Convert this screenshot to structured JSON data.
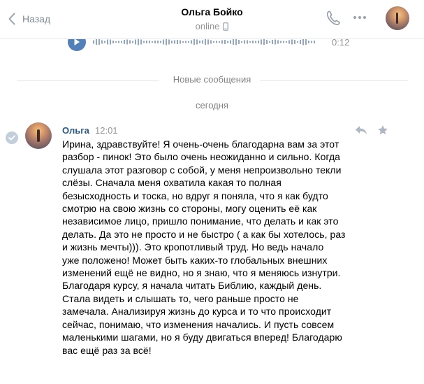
{
  "header": {
    "back_label": "Назад",
    "title": "Ольга Бойко",
    "status": "online"
  },
  "audio": {
    "duration": "0:12"
  },
  "separators": {
    "new_messages": "Новые сообщения",
    "date": "сегодня"
  },
  "message": {
    "author": "Ольга",
    "time": "12:01",
    "lines": [
      "Ирина, здравствуйте! Я очень-очень благодарна вам за этот",
      "разбор - пинок! Это было очень неожиданно и сильно. Когда",
      "слушала этот разговор с собой, у меня непроизвольно текли",
      "слёзы. Сначала меня охватила какая то полная",
      "безысходность и тоска, но вдруг я поняла, что я как будто",
      "смотрю на свою жизнь со стороны, могу оценить её как",
      "независимое лицо, пришло понимание, что делать и как это",
      "делать. Да это не просто и не быстро ( а как бы хотелось, раз",
      "и жизнь мечты))). Это кропотливый труд. Но ведь начало",
      "уже положено! Может быть каких-то глобальных внешних",
      "изменений ещё не видно, но я знаю, что я меняюсь изнутри.",
      "Благодаря курсу, я начала читать Библию, каждый день.",
      "Стала видеть и слышать то, чего раньше просто не",
      "замечала. Анализируя жизнь до курса и то что происходит",
      "сейчас, понимаю, что изменения начались. И пусть совсем",
      "маленькими шагами, но я буду двигаться вперед! Благодарю",
      "вас ещё раз за всё!"
    ]
  },
  "colors": {
    "accent": "#5181b8",
    "link": "#2a5885",
    "muted": "#939393"
  },
  "icons": {
    "back": "chevron-left-icon",
    "call": "phone-icon",
    "more": "more-icon",
    "play": "play-icon",
    "reply": "reply-icon",
    "favorite": "star-icon",
    "read": "check-icon"
  }
}
